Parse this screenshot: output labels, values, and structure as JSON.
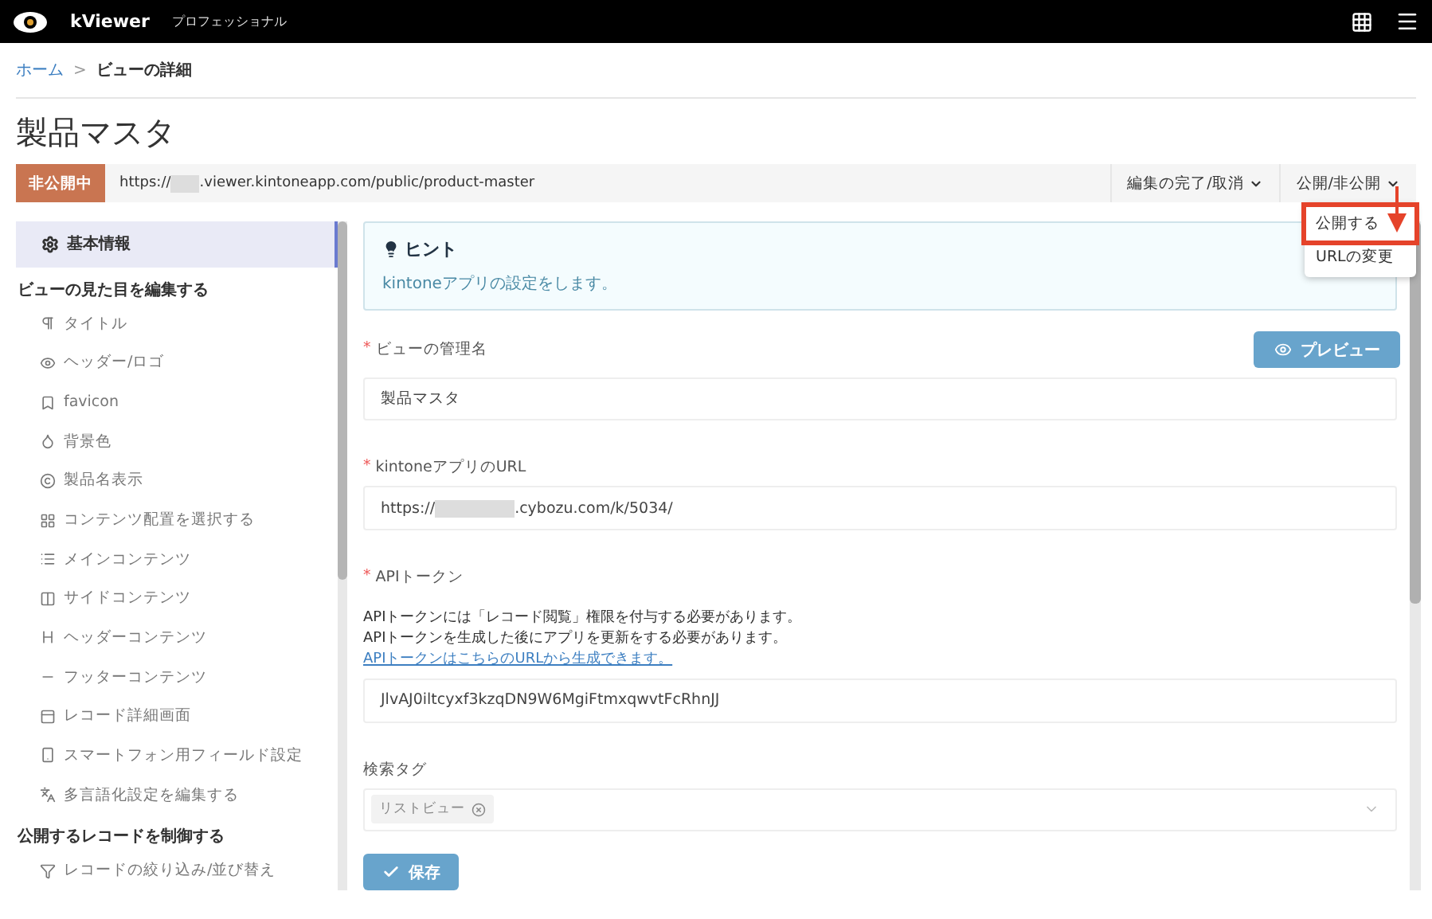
{
  "header": {
    "brand": "kViewer",
    "edition": "プロフェッショナル"
  },
  "breadcrumb": {
    "home": "ホーム",
    "separator": ">",
    "current": "ビューの詳細"
  },
  "page_title": "製品マスタ",
  "status_bar": {
    "badge": "非公開中",
    "url_prefix": "https://",
    "url_rest": ".viewer.kintoneapp.com/public/product-master",
    "menus": [
      {
        "label": "編集の完了/取消"
      },
      {
        "label": "公開/非公開"
      }
    ]
  },
  "dropdown": {
    "items": [
      {
        "label": "公開する",
        "highlighted": true
      },
      {
        "label": "URLの変更",
        "highlighted": false
      }
    ]
  },
  "sidebar": {
    "entries": [
      {
        "kind": "main",
        "label": "基本情報",
        "selected": true
      },
      {
        "kind": "heading",
        "label": "ビューの見た目を編集する"
      },
      {
        "kind": "sub",
        "label": "タイトル",
        "selected": false
      },
      {
        "kind": "sub",
        "label": "ヘッダー/ロゴ",
        "selected": false
      },
      {
        "kind": "sub",
        "label": "favicon",
        "selected": false
      },
      {
        "kind": "sub",
        "label": "背景色",
        "selected": false
      },
      {
        "kind": "sub",
        "label": "製品名表示",
        "selected": false
      },
      {
        "kind": "sub",
        "label": "コンテンツ配置を選択する",
        "selected": false
      },
      {
        "kind": "sub",
        "label": "メインコンテンツ",
        "selected": false
      },
      {
        "kind": "sub",
        "label": "サイドコンテンツ",
        "selected": false
      },
      {
        "kind": "sub",
        "label": "ヘッダーコンテンツ",
        "selected": false
      },
      {
        "kind": "sub",
        "label": "フッターコンテンツ",
        "selected": false
      },
      {
        "kind": "sub",
        "label": "レコード詳細画面",
        "selected": false
      },
      {
        "kind": "sub",
        "label": "スマートフォン用フィールド設定",
        "selected": false
      },
      {
        "kind": "sub",
        "label": "多言語化設定を編集する",
        "selected": false
      },
      {
        "kind": "heading",
        "label": "公開するレコードを制御する"
      },
      {
        "kind": "sub",
        "label": "レコードの絞り込み/並び替え",
        "selected": false
      }
    ]
  },
  "hint": {
    "title": "ヒント",
    "text": "kintoneアプリの設定をします。"
  },
  "preview_button": "プレビュー",
  "form": {
    "view_name": {
      "label": "ビューの管理名",
      "required_mark": "*",
      "value": "製品マスタ"
    },
    "app_url": {
      "label": "kintoneアプリのURL",
      "required_mark": "*",
      "value_prefix": "https://",
      "value_rest": ".cybozu.com/k/5034/"
    },
    "api_token": {
      "label": "APIトークン",
      "required_mark": "*",
      "notes": [
        "APIトークンには「レコード閲覧」権限を付与する必要があります。",
        "APIトークンを生成した後にアプリを更新をする必要があります。"
      ],
      "link": "APIトークンはこちらのURLから生成できます。",
      "value": "JlvAJ0iltcyxf3kzqDN9W6MgiFtmxqwvtFcRhnJJ"
    },
    "search_tags": {
      "label": "検索タグ",
      "tags": [
        "リストビュー"
      ]
    }
  },
  "save_button": "保存"
}
